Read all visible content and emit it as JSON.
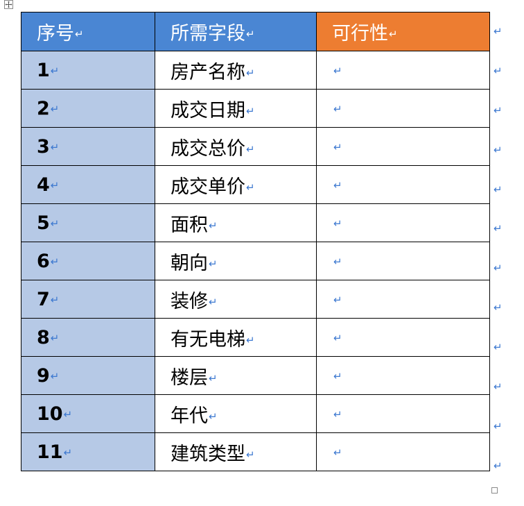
{
  "table": {
    "headers": {
      "seq": "序号",
      "field": "所需字段",
      "feasibility": "可行性"
    },
    "rows": [
      {
        "seq": "1",
        "field": "房产名称",
        "feasibility": ""
      },
      {
        "seq": "2",
        "field": "成交日期",
        "feasibility": ""
      },
      {
        "seq": "3",
        "field": "成交总价",
        "feasibility": ""
      },
      {
        "seq": "4",
        "field": "成交单价",
        "feasibility": ""
      },
      {
        "seq": "5",
        "field": "面积",
        "feasibility": ""
      },
      {
        "seq": "6",
        "field": "朝向",
        "feasibility": ""
      },
      {
        "seq": "7",
        "field": "装修",
        "feasibility": ""
      },
      {
        "seq": "8",
        "field": "有无电梯",
        "feasibility": ""
      },
      {
        "seq": "9",
        "field": "楼层",
        "feasibility": ""
      },
      {
        "seq": "10",
        "field": "年代",
        "feasibility": ""
      },
      {
        "seq": "11",
        "field": "建筑类型",
        "feasibility": ""
      }
    ]
  },
  "marks": {
    "cell_end": "↵",
    "row_end": "↵"
  },
  "colors": {
    "header_blue": "#4a86d3",
    "header_orange": "#ed7d31",
    "seq_column_fill": "#b6c9e6",
    "paragraph_mark": "#3c78d0"
  },
  "icons": {
    "move_handle": "move-arrows-icon",
    "resize_handle": "resize-square-icon"
  }
}
